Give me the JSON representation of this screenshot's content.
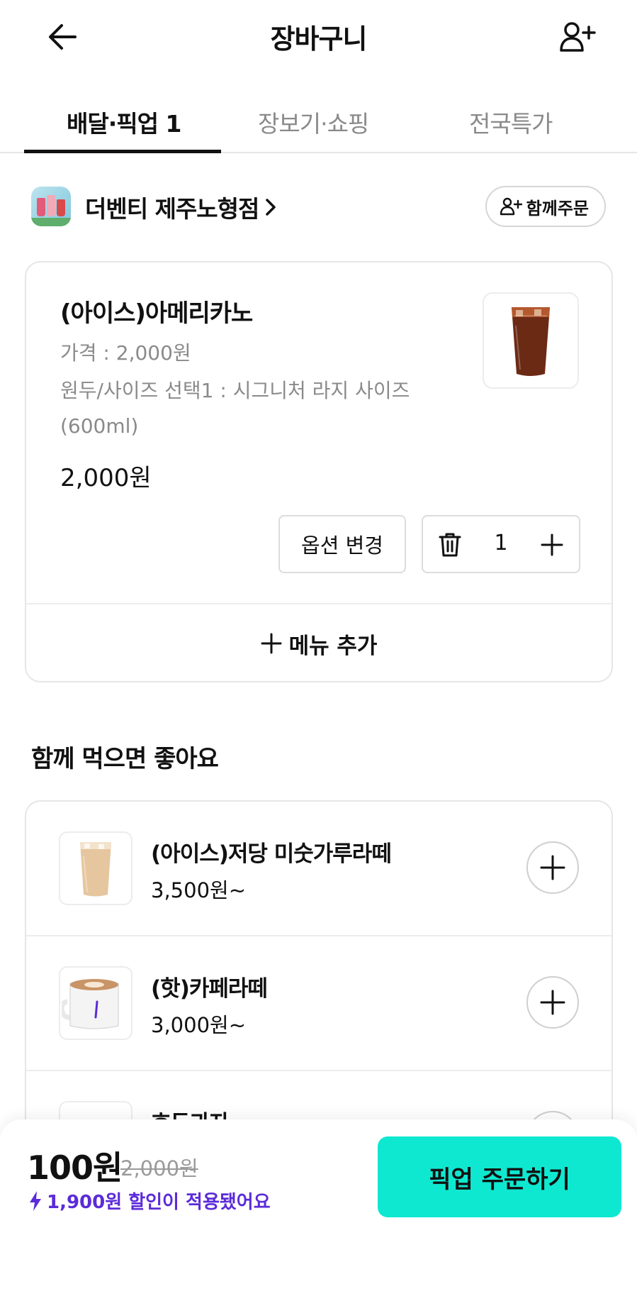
{
  "header": {
    "title": "장바구니"
  },
  "tabs": [
    {
      "label": "배달·픽업 1"
    },
    {
      "label": "장보기·쇼핑"
    },
    {
      "label": "전국특가"
    }
  ],
  "store": {
    "name": "더벤티 제주노형점",
    "group_order_label": "함께주문"
  },
  "cart_item": {
    "name": "(아이스)아메리카노",
    "price_line": "가격 : 2,000원",
    "option_line": "원두/사이즈 선택1 : 시그니처 라지 사이즈 (600ml)",
    "total": "2,000원",
    "option_change_label": "옵션 변경",
    "quantity": "1"
  },
  "add_menu_label": "메뉴 추가",
  "recommend": {
    "title": "함께 먹으면 좋아요",
    "items": [
      {
        "name": "(아이스)저당 미숫가루라떼",
        "price": "3,500원~"
      },
      {
        "name": "(핫)카페라떼",
        "price": "3,000원~"
      },
      {
        "name": "호두과자",
        "price": ""
      }
    ]
  },
  "bottom": {
    "final_price": "100원",
    "original_price": "2,000원",
    "discount_note": "1,900원 할인이 적용됐어요",
    "order_button_label": "픽업 주문하기"
  },
  "colors": {
    "accent": "#0fe8d0",
    "discount": "#5b2bd9"
  }
}
